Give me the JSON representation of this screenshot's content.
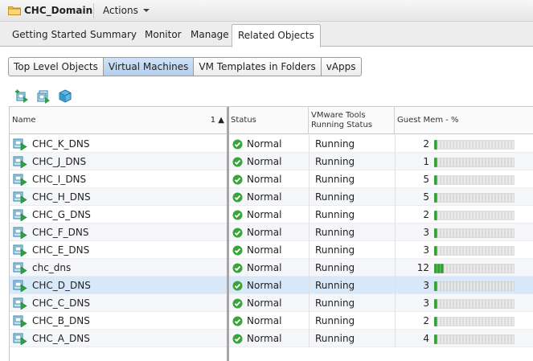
{
  "title": {
    "text": "CHC_Domain",
    "actions_label": "Actions"
  },
  "tabs": [
    "Getting Started",
    "Summary",
    "Monitor",
    "Manage",
    "Related Objects"
  ],
  "active_tab": "Related Objects",
  "subtabs": [
    "Top Level Objects",
    "Virtual Machines",
    "VM Templates in Folders",
    "vApps"
  ],
  "active_subtab": "Virtual Machines",
  "toolbar_icons": [
    "new-vm-icon",
    "deploy-vm-icon",
    "ovf-template-icon"
  ],
  "columns": {
    "name": "Name",
    "sort_indicator": "1 ▲",
    "status": "Status",
    "tools": "VMware Tools Running Status",
    "mem": "Guest Mem - %"
  },
  "colors": {
    "accent": "#b3cfee",
    "ok": "#3aa33a",
    "selected": "#d8e8f8",
    "bar_fill": "#2aa72a"
  },
  "rows": [
    {
      "name": "CHC_K_DNS",
      "status": "Normal",
      "tools": "Running",
      "mem": 2
    },
    {
      "name": "CHC_J_DNS",
      "status": "Normal",
      "tools": "Running",
      "mem": 1
    },
    {
      "name": "CHC_I_DNS",
      "status": "Normal",
      "tools": "Running",
      "mem": 5
    },
    {
      "name": "CHC_H_DNS",
      "status": "Normal",
      "tools": "Running",
      "mem": 5
    },
    {
      "name": "CHC_G_DNS",
      "status": "Normal",
      "tools": "Running",
      "mem": 2
    },
    {
      "name": "CHC_F_DNS",
      "status": "Normal",
      "tools": "Running",
      "mem": 3
    },
    {
      "name": "CHC_E_DNS",
      "status": "Normal",
      "tools": "Running",
      "mem": 3
    },
    {
      "name": "chc_dns",
      "status": "Normal",
      "tools": "Running",
      "mem": 12
    },
    {
      "name": "CHC_D_DNS",
      "status": "Normal",
      "tools": "Running",
      "mem": 3,
      "selected": true
    },
    {
      "name": "CHC_C_DNS",
      "status": "Normal",
      "tools": "Running",
      "mem": 3
    },
    {
      "name": "CHC_B_DNS",
      "status": "Normal",
      "tools": "Running",
      "mem": 2
    },
    {
      "name": "CHC_A_DNS",
      "status": "Normal",
      "tools": "Running",
      "mem": 4
    }
  ]
}
